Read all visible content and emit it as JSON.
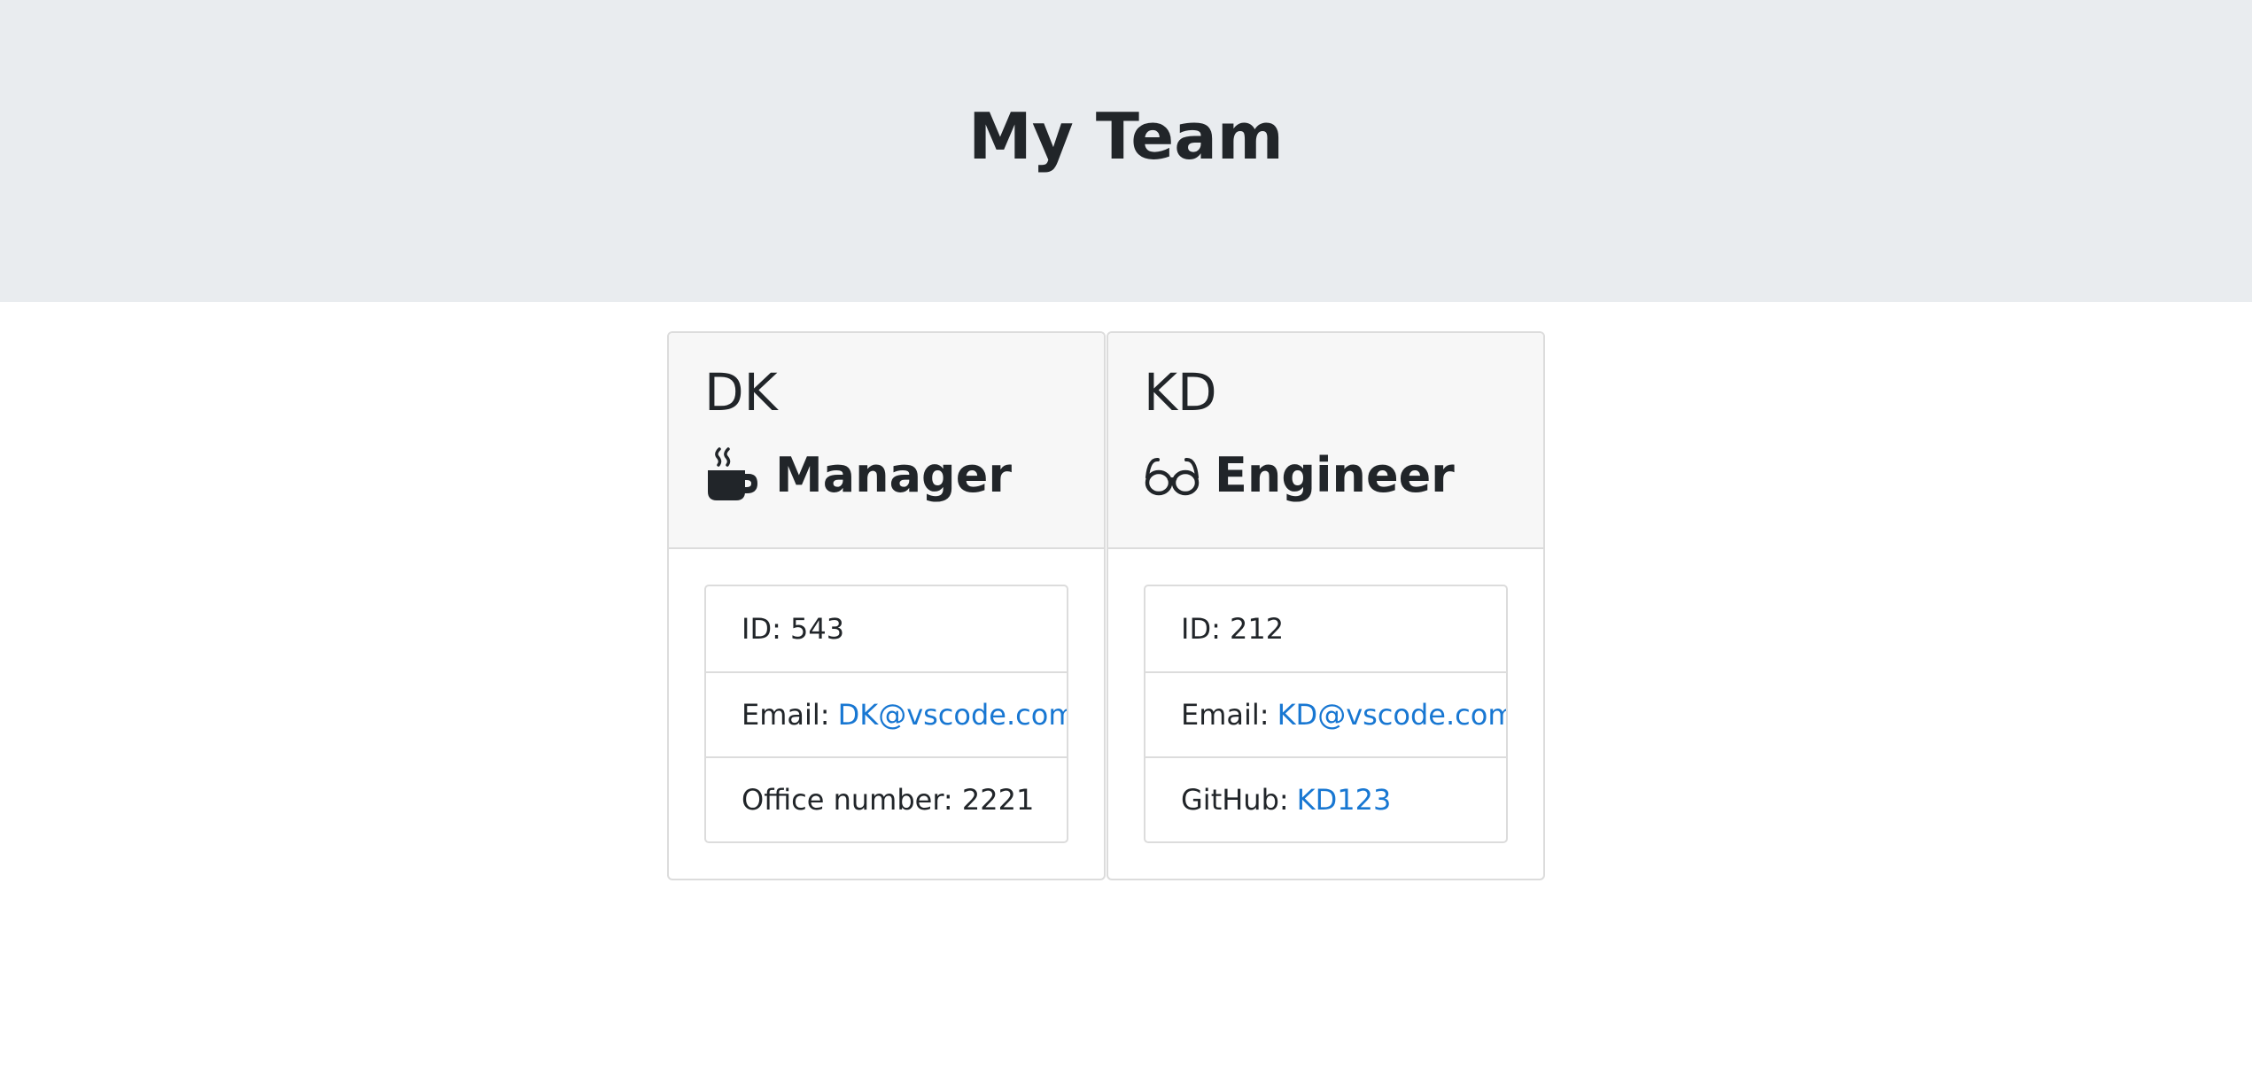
{
  "header": {
    "title": "My Team"
  },
  "cards": [
    {
      "name": "DK",
      "role": "Manager",
      "role_icon": "mug-hot-icon",
      "id_label": "ID:",
      "id_value": "543",
      "email_label": "Email:",
      "email": "DK@vscode.com",
      "extra_label": "Office number:",
      "extra_value": "2221"
    },
    {
      "name": "KD",
      "role": "Engineer",
      "role_icon": "glasses-icon",
      "id_label": "ID:",
      "id_value": "212",
      "email_label": "Email:",
      "email": "KD@vscode.com",
      "extra_label": "GitHub:",
      "extra_value": "KD123"
    }
  ],
  "colors": {
    "header_bg": "#e9ecef",
    "card_header_bg": "#f7f7f7",
    "link": "#1877d2",
    "text": "#212529"
  }
}
